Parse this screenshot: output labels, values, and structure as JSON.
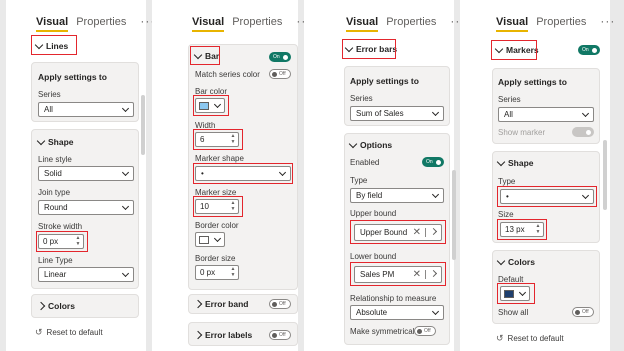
{
  "tabs": {
    "visual": "Visual",
    "properties": "Properties",
    "more": "···"
  },
  "p1": {
    "lines": "Lines",
    "apply": "Apply settings to",
    "series_label": "Series",
    "series_value": "All",
    "shape": "Shape",
    "line_style_label": "Line style",
    "line_style_value": "Solid",
    "join_type_label": "Join type",
    "join_type_value": "Round",
    "stroke_label": "Stroke width",
    "stroke_value": "0 px",
    "line_type_label": "Line Type",
    "line_type_value": "Linear",
    "colors": "Colors",
    "reset": "Reset to default"
  },
  "p2": {
    "bar": "Bar",
    "bar_toggle": "On",
    "match": "Match series color",
    "match_toggle": "Off",
    "bar_color": "Bar color",
    "bar_color_hex": "#8cc8f0",
    "width_label": "Width",
    "width_value": "6",
    "marker_shape_label": "Marker shape",
    "marker_shape_value": "•",
    "marker_size_label": "Marker size",
    "marker_size_value": "10",
    "border_color_label": "Border color",
    "border_color_hex": "#ffffff",
    "border_size_label": "Border size",
    "border_size_value": "0 px",
    "error_band": "Error band",
    "error_band_toggle": "Off",
    "error_labels": "Error labels",
    "error_labels_toggle": "Off"
  },
  "p3": {
    "error_bars": "Error bars",
    "apply": "Apply settings to",
    "series_label": "Series",
    "series_value": "Sum of Sales",
    "options": "Options",
    "enabled_label": "Enabled",
    "enabled_toggle": "On",
    "type_label": "Type",
    "type_value": "By field",
    "upper_label": "Upper bound",
    "upper_value": "Upper Bound",
    "lower_label": "Lower bound",
    "lower_value": "Sales PM",
    "relationship_label": "Relationship to measure",
    "relationship_value": "Absolute",
    "symmetric_label": "Make symmetrical",
    "symmetric_toggle": "Off"
  },
  "p4": {
    "markers": "Markers",
    "markers_toggle": "On",
    "apply": "Apply settings to",
    "series_label": "Series",
    "series_value": "All",
    "show_marker": "Show marker",
    "shape": "Shape",
    "type_label": "Type",
    "type_value": "•",
    "size_label": "Size",
    "size_value": "13 px",
    "colors": "Colors",
    "default_label": "Default",
    "default_hex": "#1f3f6e",
    "show_all": "Show all",
    "show_all_toggle": "Off",
    "reset": "Reset to default"
  }
}
